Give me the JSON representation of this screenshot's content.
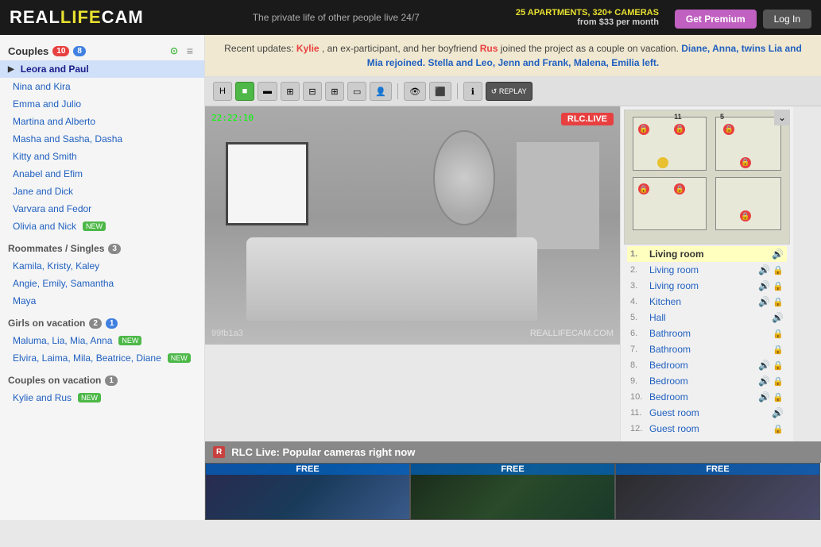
{
  "header": {
    "logo_text": "REALLIFECAM",
    "logo_real": "REAL",
    "logo_life": "LIFE",
    "logo_cam": "CAM",
    "tagline": "The private life of other people live 24/7",
    "apartments": "25 APARTMENTS, 320+ CAMERAS",
    "price": "from $33 per month",
    "btn_premium": "Get Premium",
    "btn_login": "Log In"
  },
  "sidebar": {
    "section_couples": "Couples",
    "couples_count": "10",
    "couples_count2": "8",
    "couples": [
      {
        "name": "Leora and Paul",
        "active": true,
        "new": false
      },
      {
        "name": "Nina and Kira",
        "active": false,
        "new": false
      },
      {
        "name": "Emma and Julio",
        "active": false,
        "new": false
      },
      {
        "name": "Martina and Alberto",
        "active": false,
        "new": false
      },
      {
        "name": "Masha and Sasha, Dasha",
        "active": false,
        "new": false
      },
      {
        "name": "Kitty and Smith",
        "active": false,
        "new": false
      },
      {
        "name": "Anabel and Efim",
        "active": false,
        "new": false
      },
      {
        "name": "Jane and Dick",
        "active": false,
        "new": false
      },
      {
        "name": "Varvara and Fedor",
        "active": false,
        "new": false
      },
      {
        "name": "Olivia and Nick",
        "active": false,
        "new": true
      }
    ],
    "section_roommates": "Roommates / Singles",
    "roommates_count": "3",
    "roommates": [
      {
        "name": "Kamila, Kristy, Kaley",
        "new": false
      },
      {
        "name": "Angie, Emily, Samantha",
        "new": false
      },
      {
        "name": "Maya",
        "new": false
      }
    ],
    "section_girls": "Girls on vacation",
    "girls_count": "2",
    "girls_count2": "1",
    "girls": [
      {
        "name": "Maluma, Lia, Mia, Anna",
        "new": true
      },
      {
        "name": "Elvira, Laima, Mila, Beatrice, Diane",
        "new": true
      }
    ],
    "section_couples_vacation": "Couples on vacation",
    "couples_vacation_count": "1",
    "couples_vacation": [
      {
        "name": "Kylie and Rus",
        "new": true
      }
    ]
  },
  "notification": {
    "text1": "Recent updates: ",
    "kylie": "Kylie",
    "text2": ", an ex-participant, and her boyfriend ",
    "rus": "Rus",
    "text3": " joined the project as a couple on vacation. ",
    "text4": "Diane, Anna, twins Lia and Mia rejoined. ",
    "text5": "Stella and Leo, Jenn and Frank, Malena, Emilia left."
  },
  "toolbar": {
    "btn_h": "H",
    "timestamp": "22:22:10"
  },
  "video": {
    "live_label": "RLC.LIVE",
    "cam_id": "99fb1a3",
    "watermark": "REALLIFECAM.COM",
    "timestamp": "22:22:10"
  },
  "rooms": [
    {
      "num": "1.",
      "name": "Living room",
      "active": true,
      "sound": true,
      "lock": false
    },
    {
      "num": "2.",
      "name": "Living room",
      "active": false,
      "sound": true,
      "lock": true
    },
    {
      "num": "3.",
      "name": "Living room",
      "active": false,
      "sound": true,
      "lock": true
    },
    {
      "num": "4.",
      "name": "Kitchen",
      "active": false,
      "sound": true,
      "lock": true
    },
    {
      "num": "5.",
      "name": "Hall",
      "active": false,
      "sound": true,
      "lock": false
    },
    {
      "num": "6.",
      "name": "Bathroom",
      "active": false,
      "sound": false,
      "lock": true
    },
    {
      "num": "7.",
      "name": "Bathroom",
      "active": false,
      "sound": false,
      "lock": true
    },
    {
      "num": "8.",
      "name": "Bedroom",
      "active": false,
      "sound": true,
      "lock": true
    },
    {
      "num": "9.",
      "name": "Bedroom",
      "active": false,
      "sound": true,
      "lock": true
    },
    {
      "num": "10.",
      "name": "Bedroom",
      "active": false,
      "sound": true,
      "lock": true
    },
    {
      "num": "11.",
      "name": "Guest room",
      "active": false,
      "sound": true,
      "lock": false
    },
    {
      "num": "12.",
      "name": "Guest room",
      "active": false,
      "sound": false,
      "lock": true
    }
  ],
  "bottom": {
    "rlc_label": "R",
    "title": "RLC Live: Popular cameras right now",
    "cams": [
      {
        "label": "FREE"
      },
      {
        "label": "FREE"
      },
      {
        "label": "FREE"
      }
    ]
  },
  "icons": {
    "sound": "🔊",
    "lock": "🔒",
    "eye": "👁",
    "expand": "⌄",
    "camera": "📷",
    "list": "≡",
    "green_dot": "●"
  },
  "colors": {
    "accent_green": "#4db848",
    "accent_red": "#e84040",
    "accent_purple": "#c060c0",
    "brand_yellow": "#e8e030",
    "link_blue": "#2060c0"
  }
}
